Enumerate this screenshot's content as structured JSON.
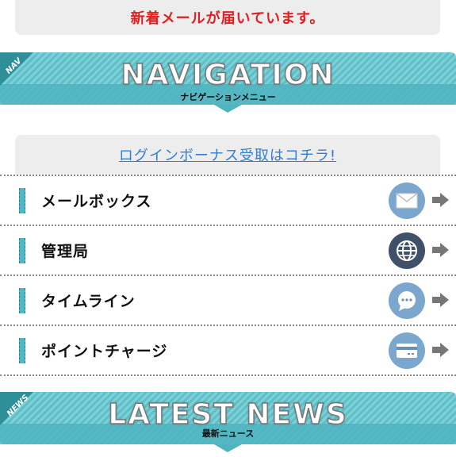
{
  "notice": {
    "text": "新着メールが届いています。"
  },
  "nav_banner": {
    "corner": "NAV",
    "title": "NAVIGATION",
    "subtitle": "ナビゲーションメニュー"
  },
  "bonus_link": {
    "text": "ログインボーナス受取はコチラ!"
  },
  "menu": {
    "items": [
      {
        "label": "メールボックス",
        "icon": "mail-icon",
        "color": "#7ba7cf"
      },
      {
        "label": "管理局",
        "icon": "globe-icon",
        "color": "#3f5169"
      },
      {
        "label": "タイムライン",
        "icon": "chat-bubble-icon",
        "color": "#7ba7cf"
      },
      {
        "label": "ポイントチャージ",
        "icon": "credit-card-icon",
        "color": "#7ba7cf"
      }
    ]
  },
  "news_banner": {
    "corner": "NEWS",
    "title": "LATEST NEWS",
    "subtitle": "最新ニュース"
  },
  "colors": {
    "accent": "#4fb8c4",
    "notice_text": "#e02020",
    "link": "#2f7fd8"
  }
}
